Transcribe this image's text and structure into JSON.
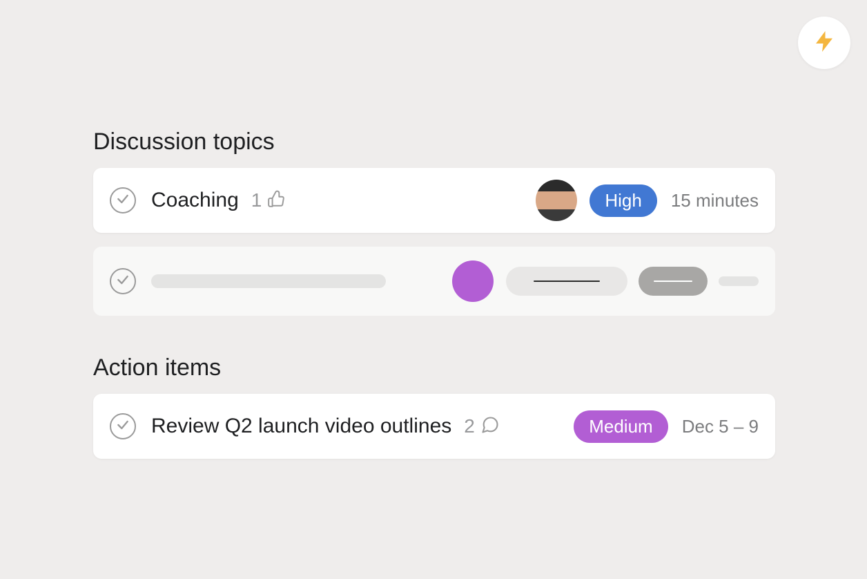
{
  "fab": {
    "icon": "lightning-icon"
  },
  "sections": {
    "discussion": {
      "heading": "Discussion topics",
      "items": [
        {
          "title": "Coaching",
          "likes": "1",
          "priority_label": "High",
          "priority_color": "blue",
          "duration": "15 minutes"
        }
      ]
    },
    "action": {
      "heading": "Action items",
      "items": [
        {
          "title": "Review Q2 launch video outlines",
          "comments": "2",
          "priority_label": "Medium",
          "priority_color": "purple",
          "date": "Dec 5 – 9"
        }
      ]
    }
  }
}
